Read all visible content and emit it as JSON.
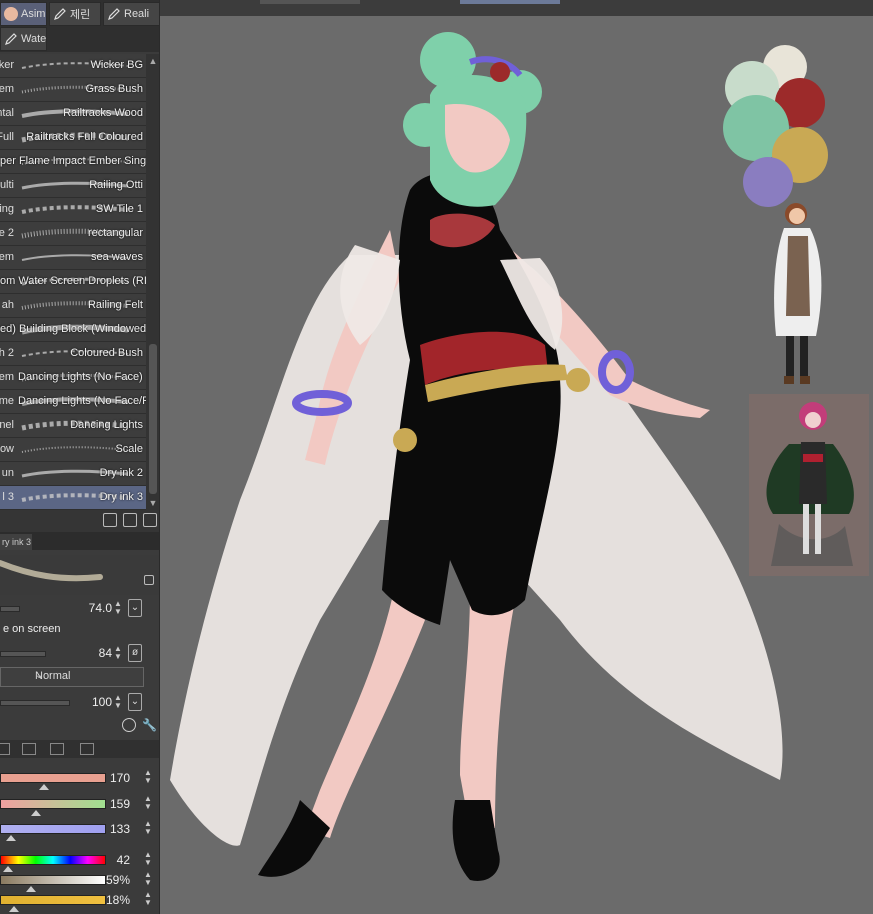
{
  "brush_tabs": [
    {
      "label": "Asim",
      "icon": "avatar-icon",
      "active": true
    },
    {
      "label": "제린",
      "icon": "pen-icon",
      "active": false
    },
    {
      "label": "Reali",
      "icon": "pen-icon",
      "active": false
    },
    {
      "label": "Wate",
      "icon": "pen-icon",
      "active": false
    }
  ],
  "brush_list": [
    {
      "left_text": "icker",
      "name": "Wicker BG"
    },
    {
      "left_text": "em",
      "name": "Grass Bush"
    },
    {
      "left_text": "ntal",
      "name": "Railtracks Wood"
    },
    {
      "left_text": "Full",
      "name": "Railtracks Full Coloured"
    },
    {
      "left_text": "",
      "overlay": "per Flame Impact Ember Single",
      "name": ""
    },
    {
      "left_text": "ulti",
      "name": "Railing Otti"
    },
    {
      "left_text": "ing",
      "name": "SW Tile 1"
    },
    {
      "left_text": "e 2",
      "name": "rectangular"
    },
    {
      "left_text": "em",
      "name": "sea waves"
    },
    {
      "left_text": "",
      "overlay": "om Water Screen Droplets (RI",
      "name": ""
    },
    {
      "left_text": "ah",
      "name": "Railing Felt"
    },
    {
      "left_text": "",
      "overlay": "ed) Building Block (Windowed)",
      "name": ""
    },
    {
      "left_text": "h 2",
      "name": "Coloured Bush"
    },
    {
      "left_text": "em",
      "overlay": "Dancing Lights (No Face)",
      "name": ""
    },
    {
      "left_text": "me",
      "overlay": "Dancing Lights (No Face/F",
      "name": ""
    },
    {
      "left_text": "nel",
      "name": "Dancing Lights"
    },
    {
      "left_text": "ow",
      "name": "Scale"
    },
    {
      "left_text": "un",
      "name": "Dry ink 2"
    },
    {
      "left_text": "l 3",
      "name": "Dry ink 3",
      "selected": true
    }
  ],
  "tool_property": {
    "tab_label": "ry ink 3",
    "brush_size": "74.0",
    "size_option_label": "e on screen",
    "opacity": "84",
    "blend_mode": "Normal",
    "density": "100"
  },
  "color_sliders": [
    {
      "value": "170",
      "gradient": "linear-gradient(to right,#e8a090 0%,#e8a090 100%)"
    },
    {
      "value": "159",
      "gradient": "linear-gradient(to right,#f0a0a0 0%,#a0e090 100%)"
    },
    {
      "value": "133",
      "gradient": "linear-gradient(to right,#b0b0f0 0%,#a0a0f0 100%)"
    },
    {
      "value": "42",
      "gradient": "linear-gradient(to right,#ff0000,#ffff00,#00ff00,#00ffff,#0000ff,#ff00ff,#ff0000)"
    },
    {
      "value": "59%",
      "gradient": "linear-gradient(to right,#8a7a60,#ffffff)"
    },
    {
      "value": "18%",
      "gradient": "linear-gradient(to right,#e0b030,#f0c040)"
    }
  ],
  "palette_colors": [
    "#e8e4d8",
    "#c8dccb",
    "#9c2a2a",
    "#7fc4a4",
    "#c9a954",
    "#8a7dc0"
  ],
  "character_colors": {
    "hair": "#7fd0aa",
    "skin": "#f2c9c3",
    "outfit": "#0b0b0b",
    "sash": "#b3282e",
    "gold": "#c9a954",
    "coat": "#efe9e6",
    "bracelet": "#7060d8"
  }
}
